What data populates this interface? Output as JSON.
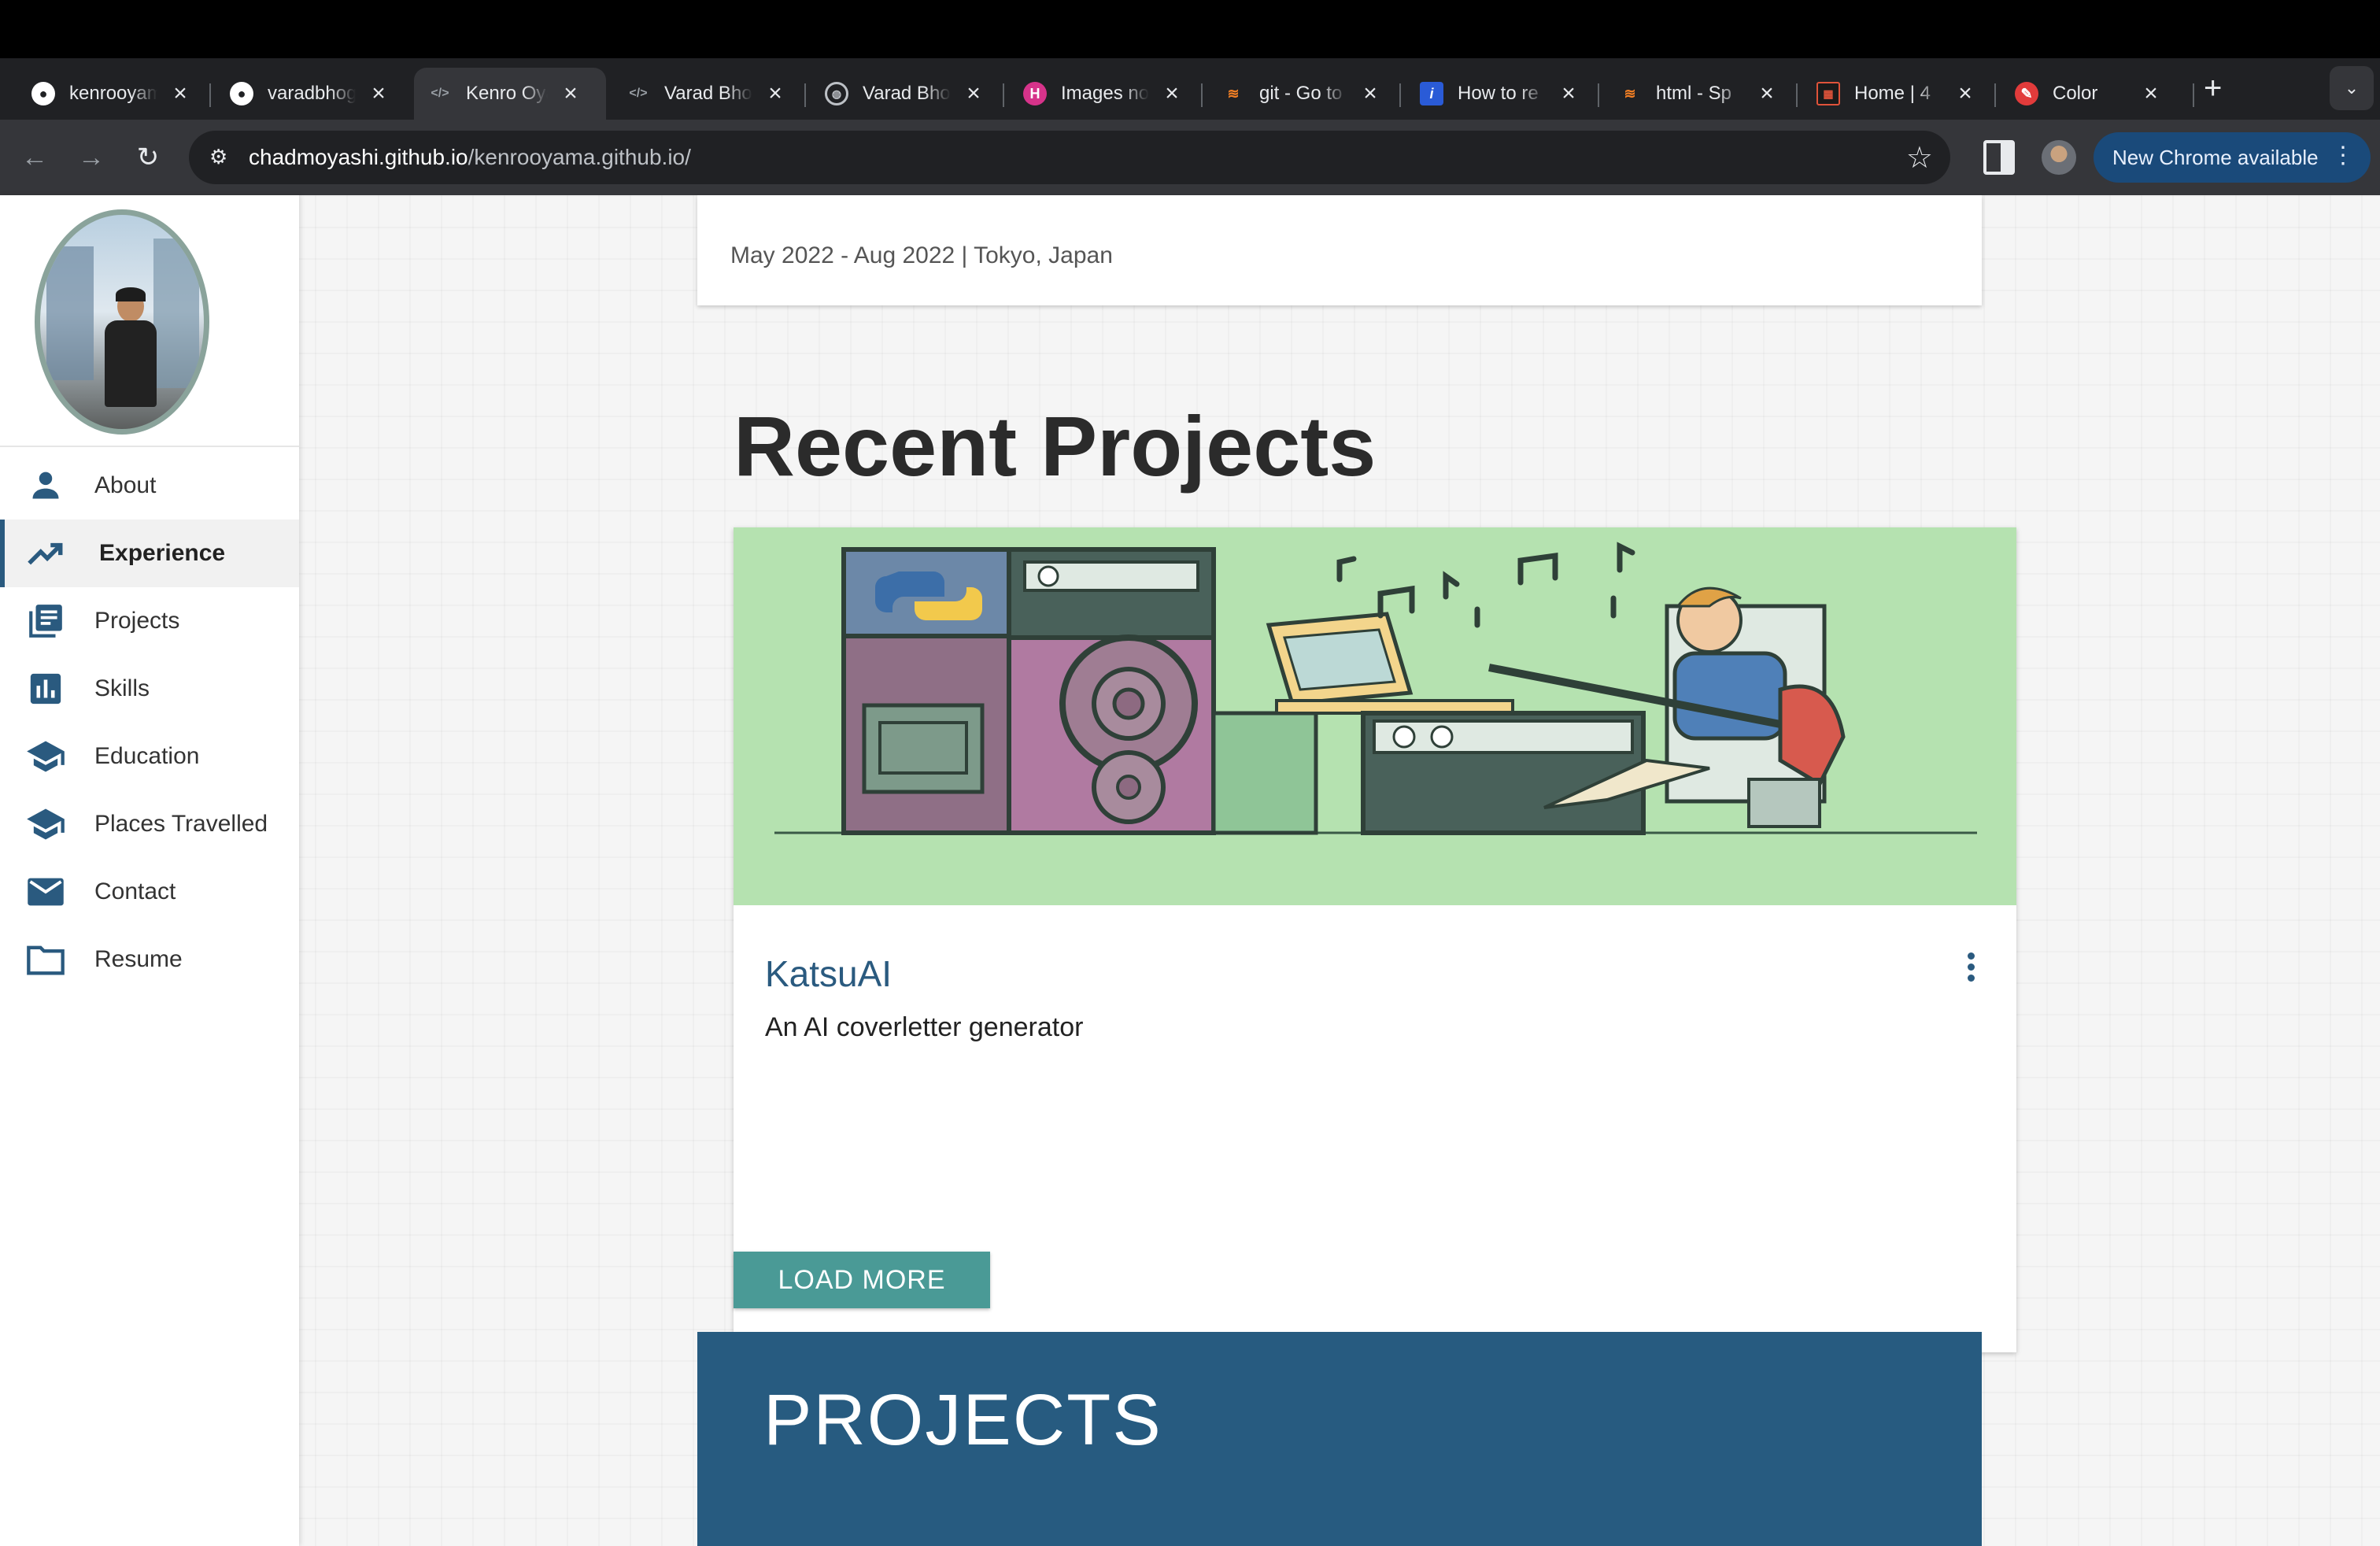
{
  "browser": {
    "tabs": [
      {
        "title": "kenrooyama",
        "favicon": "github-icon",
        "active": false
      },
      {
        "title": "varadbhogayata",
        "favicon": "github-icon",
        "active": false
      },
      {
        "title": "Kenro Oyama",
        "favicon": "code-icon",
        "active": true
      },
      {
        "title": "Varad Bhogayata",
        "favicon": "code-icon",
        "active": false
      },
      {
        "title": "Varad Bhogayata",
        "favicon": "globe-icon",
        "active": false
      },
      {
        "title": "Images not",
        "favicon": "h-icon",
        "active": false
      },
      {
        "title": "git - Go to",
        "favicon": "stack-icon",
        "active": false
      },
      {
        "title": "How to re",
        "favicon": "info-icon",
        "active": false
      },
      {
        "title": "html - Sp",
        "favicon": "stack-icon",
        "active": false
      },
      {
        "title": "Home | 4",
        "favicon": "grid-icon",
        "active": false
      },
      {
        "title": "Color",
        "favicon": "color-icon",
        "active": false
      }
    ],
    "url_host": "chadmoyashi.github.io",
    "url_path": "/kenrooyama.github.io/",
    "update_chip": "New Chrome available"
  },
  "sidebar": {
    "items": [
      {
        "label": "About",
        "icon": "person-icon",
        "active": false
      },
      {
        "label": "Experience",
        "icon": "trending-up-icon",
        "active": true
      },
      {
        "label": "Projects",
        "icon": "library-books-icon",
        "active": false
      },
      {
        "label": "Skills",
        "icon": "bar-chart-icon",
        "active": false
      },
      {
        "label": "Education",
        "icon": "school-icon",
        "active": false
      },
      {
        "label": "Places Travelled",
        "icon": "school-icon",
        "active": false
      },
      {
        "label": "Contact",
        "icon": "mail-icon",
        "active": false
      },
      {
        "label": "Resume",
        "icon": "folder-icon",
        "active": false
      }
    ]
  },
  "main": {
    "previous_card_meta": "May 2022 - Aug 2022 | Tokyo, Japan",
    "section_title": "Recent Projects",
    "project": {
      "title": "KatsuAI",
      "description": "An AI coverletter generator"
    },
    "load_more_label": "LOAD MORE",
    "banner_title": "PROJECTS"
  },
  "colors": {
    "accent": "#2a5a7f",
    "button": "#4a9a96",
    "banner": "#275b80",
    "project_image_bg": "#b5e2b0"
  }
}
